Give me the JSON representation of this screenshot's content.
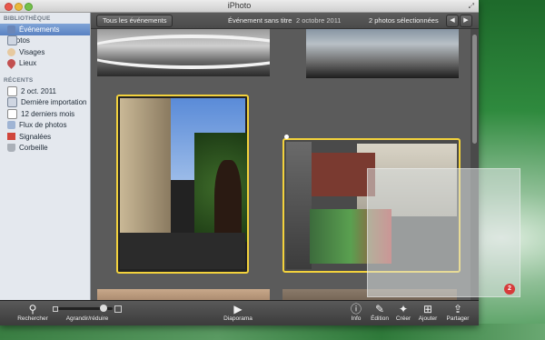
{
  "window": {
    "title": "iPhoto"
  },
  "sidebar": {
    "sections": [
      {
        "title": "BIBLIOTHÈQUE",
        "items": [
          "Événements",
          "Photos",
          "Visages",
          "Lieux"
        ]
      },
      {
        "title": "RÉCENTS",
        "items": [
          "2 oct. 2011",
          "Dernière importation",
          "12 derniers mois",
          "Flux de photos",
          "Signalées",
          "Corbeille"
        ]
      }
    ],
    "selected": "Événements"
  },
  "topbar": {
    "all_events": "Tous les événements",
    "event_title": "Événement sans titre",
    "event_date": "2 octobre 2011",
    "selection": "2 photos sélectionnées",
    "prev_icon": "arrow-left-icon",
    "next_icon": "arrow-right-icon"
  },
  "drag": {
    "badge": "2"
  },
  "bottombar": {
    "search": "Rechercher",
    "zoom": "Agrandir/réduire",
    "slideshow": "Diaporama",
    "info": "Info",
    "edit": "Édition",
    "create": "Créer",
    "add": "Ajouter",
    "share": "Partager"
  },
  "colors": {
    "selection_border": "#f3d23c",
    "sidebar_selected": "#5a82c2"
  }
}
